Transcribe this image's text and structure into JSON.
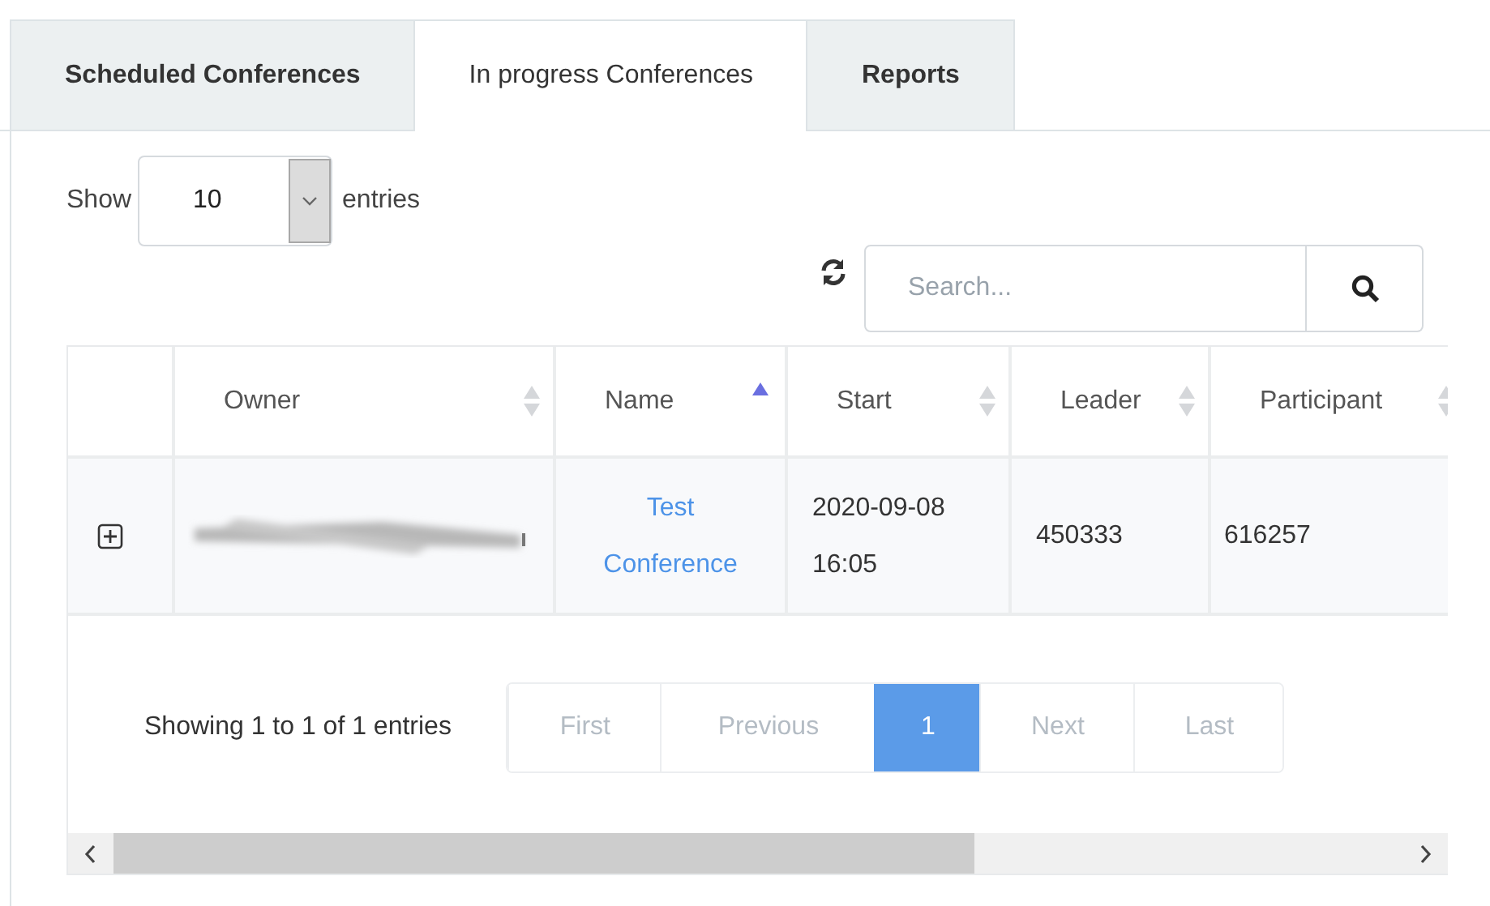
{
  "tabs": [
    {
      "label": "Scheduled Conferences",
      "selected": false
    },
    {
      "label": "In progress Conferences",
      "selected": true
    },
    {
      "label": "Reports",
      "selected": false
    }
  ],
  "length_menu": {
    "before": "Show",
    "value": "10",
    "after": "entries"
  },
  "search": {
    "placeholder": "Search..."
  },
  "table": {
    "columns": [
      {
        "label": "Owner",
        "sorted_ascending": false
      },
      {
        "label": "Name",
        "sorted_ascending": true
      },
      {
        "label": "Start",
        "sorted_ascending": false
      },
      {
        "label": "Leader",
        "sorted_ascending": false
      },
      {
        "label": "Participant",
        "sorted_ascending": false
      }
    ],
    "rows": [
      {
        "expanded": false,
        "owner_redacted": true,
        "name": "Test Conference",
        "start": "2020-09-08 16:05",
        "leader": "450333",
        "participant": "616257"
      }
    ]
  },
  "info": "Showing 1 to 1 of 1 entries",
  "pagination": [
    {
      "label": "First",
      "disabled": true,
      "selected": false
    },
    {
      "label": "Previous",
      "disabled": true,
      "selected": false
    },
    {
      "label": "1",
      "disabled": false,
      "selected": true
    },
    {
      "label": "Next",
      "disabled": true,
      "selected": false
    },
    {
      "label": "Last",
      "disabled": true,
      "selected": false
    }
  ]
}
